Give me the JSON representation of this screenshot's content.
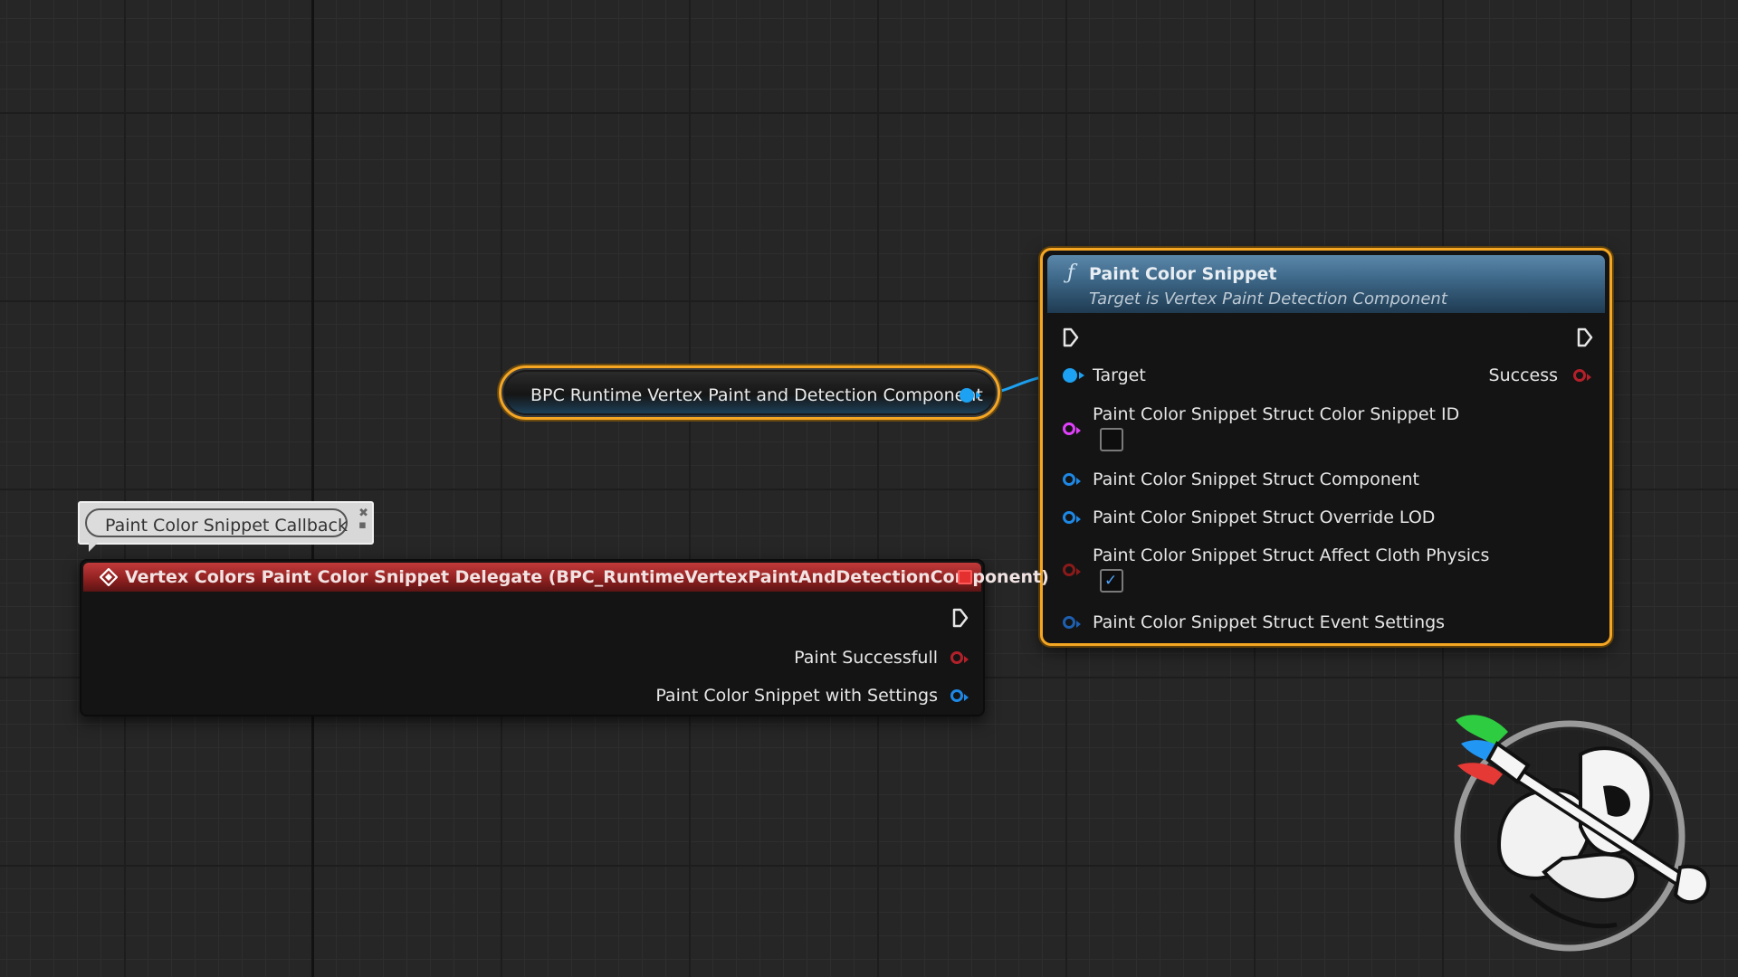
{
  "getter_node": {
    "label": "BPC Runtime Vertex Paint and Detection Component"
  },
  "function_node": {
    "glyph": "ƒ",
    "title": "Paint Color Snippet",
    "subtitle": "Target is Vertex Paint Detection Component",
    "inputs": [
      {
        "label": "Target",
        "pin": "object-pin-connected",
        "color": "#1da1f2"
      },
      {
        "label": "Paint Color Snippet Struct Color Snippet ID",
        "pin": "name-pin",
        "color": "#e040fb",
        "checkbox": false
      },
      {
        "label": "Paint Color Snippet Struct Component",
        "pin": "object-pin",
        "color": "#1e88e5"
      },
      {
        "label": "Paint Color Snippet Struct Override LOD",
        "pin": "object-pin",
        "color": "#1e88e5"
      },
      {
        "label": "Paint Color Snippet Struct Affect Cloth Physics",
        "pin": "bool-pin",
        "color": "#8b1a1a",
        "checkbox": true
      },
      {
        "label": "Paint Color Snippet Struct Event Settings",
        "pin": "struct-pin",
        "color": "#1e5fb0"
      }
    ],
    "outputs": [
      {
        "label": "Success",
        "pin": "bool-pin",
        "color": "#b3202a"
      }
    ]
  },
  "comment": {
    "text": "Paint Color Snippet Callback"
  },
  "event_node": {
    "title": "Vertex Colors Paint Color Snippet Delegate (BPC_RuntimeVertexPaintAndDetectionComponent)",
    "header_color": "#a82a2a",
    "outputs": [
      {
        "label": "Paint Successfull",
        "pin": "bool-pin",
        "color": "#b3202a"
      },
      {
        "label": "Paint Color Snippet with Settings",
        "pin": "struct-pin",
        "color": "#1e88e5"
      }
    ]
  },
  "colors": {
    "selection": "#f5a623",
    "wire": "#1da1f2",
    "grid_bg": "#262626"
  },
  "icons": [
    "function-icon",
    "exec-pin-icon",
    "event-icon",
    "delegate-pin-icon",
    "checkmark-icon",
    "plugin-logo-icon"
  ]
}
